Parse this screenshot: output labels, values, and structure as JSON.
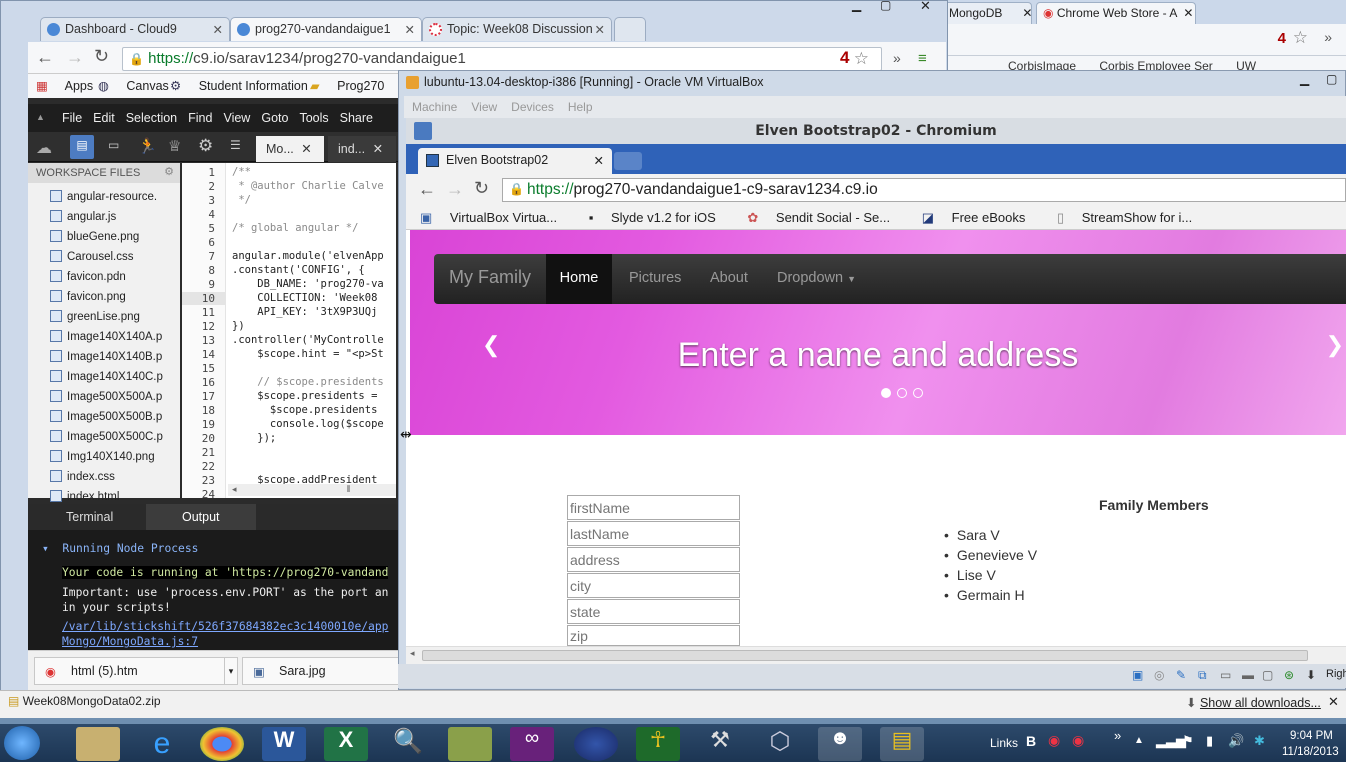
{
  "back_browser": {
    "tabs": [
      "MongoDB",
      "Chrome Web Store - A"
    ],
    "bookmarks": [
      "CorbisImage",
      "Corbis Employee Ser",
      "UW"
    ],
    "ext_count": "4"
  },
  "main_browser": {
    "tabs": [
      {
        "label": "Dashboard - Cloud9",
        "active": false
      },
      {
        "label": "prog270-vandandaigue1",
        "active": true
      },
      {
        "label": "Topic: Week08 Discussion",
        "active": false
      }
    ],
    "url_prefix": "https://",
    "url_rest": "c9.io/sarav1234/prog270-vandandaigue1",
    "ext_count": "4",
    "bookmarks": [
      "Apps",
      "Canvas",
      "Student Information",
      "Prog270"
    ]
  },
  "ide": {
    "menu": [
      "File",
      "Edit",
      "Selection",
      "Find",
      "View",
      "Goto",
      "Tools",
      "Share"
    ],
    "tabs": [
      "Mo...",
      "ind..."
    ],
    "workspace_title": "WORKSPACE FILES",
    "files": [
      "angular-resource.",
      "angular.js",
      "blueGene.png",
      "Carousel.css",
      "favicon.pdn",
      "favicon.png",
      "greenLise.png",
      "Image140X140A.p",
      "Image140X140B.p",
      "Image140X140C.p",
      "Image500X500A.p",
      "Image500X500B.p",
      "Image500X500C.p",
      "Img140X140.png",
      "index.css",
      "index.html"
    ],
    "line_numbers": [
      "1",
      "2",
      "3",
      "4",
      "5",
      "6",
      "7",
      "8",
      "9",
      "10",
      "11",
      "12",
      "13",
      "14",
      "15",
      "16",
      "17",
      "18",
      "19",
      "20",
      "21",
      "22",
      "23",
      "24"
    ],
    "code_lines": [
      "/**",
      " * @author Charlie Calve",
      " */",
      "",
      "/* global angular */",
      "",
      "angular.module('elvenApp",
      ".constant('CONFIG', {",
      "    DB_NAME: 'prog270-va",
      "    COLLECTION: 'Week08",
      "    API_KEY: '3tX9P3UQj",
      "})",
      ".controller('MyControlle",
      "    $scope.hint = \"<p>St",
      "",
      "    // $scope.presidents",
      "    $scope.presidents =",
      "      $scope.presidents",
      "      console.log($scope",
      "    });",
      "",
      "",
      "    $scope.addPresident",
      ""
    ],
    "console_tabs": [
      "Terminal",
      "Output"
    ],
    "console_title": "Running Node Process",
    "console_lines": [
      "Your code is running at 'https://prog270-vandand",
      "Important: use 'process.env.PORT' as the port an",
      "in your scripts!",
      "/var/lib/stickshift/526f37684382ec3c1400010e/app",
      "Mongo/MongoData.js:7"
    ]
  },
  "downloads_top": [
    {
      "name": "html (5).htm"
    },
    {
      "name": "Sara.jpg"
    }
  ],
  "vbox": {
    "title": "lubuntu-13.04-desktop-i386 [Running] - Oracle VM VirtualBox",
    "menu": [
      "Machine",
      "View",
      "Devices",
      "Help"
    ],
    "status_right": "Righ"
  },
  "guest_chrome": {
    "window_title": "Elven Bootstrap02 - Chromium",
    "tab_label": "Elven Bootstrap02",
    "url_prefix": "https://",
    "url_rest": "prog270-vandandaigue1-c9-sarav1234.c9.io",
    "bookmarks": [
      "VirtualBox Virtua...",
      "Slyde v1.2 for iOS",
      "Sendit Social - Se...",
      "Free eBooks",
      "StreamShow for i..."
    ]
  },
  "site": {
    "brand": "My Family",
    "nav": [
      "Home",
      "Pictures",
      "About",
      "Dropdown"
    ],
    "carousel_caption": "Enter a name and address",
    "form_placeholders": [
      "firstName",
      "lastName",
      "address",
      "city",
      "state",
      "zip"
    ],
    "family_heading": "Family Members",
    "family_members": [
      "Sara V",
      "Genevieve V",
      "Lise V",
      "Germain H"
    ]
  },
  "download_bottom": {
    "file": "Week08MongoData02.zip",
    "show_all": "Show all downloads..."
  },
  "taskbar": {
    "links_label": "Links",
    "time": "9:04 PM",
    "date": "11/18/2013"
  },
  "colors": {
    "carousel_pink": "#e35ae0",
    "ide_dark": "#2b2b2b",
    "guest_tabbar": "#2f62b8",
    "taskbar": "#1c3553"
  }
}
